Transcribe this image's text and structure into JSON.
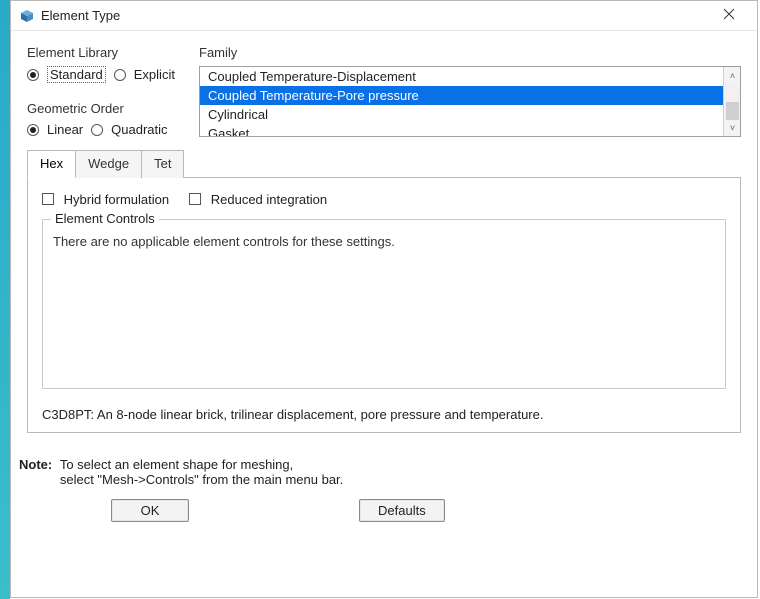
{
  "window": {
    "title": "Element Type"
  },
  "groups": {
    "element_library": {
      "label": "Element Library",
      "options": {
        "standard": "Standard",
        "explicit": "Explicit"
      },
      "selected": "standard"
    },
    "geometric_order": {
      "label": "Geometric Order",
      "options": {
        "linear": "Linear",
        "quadratic": "Quadratic"
      },
      "selected": "linear"
    },
    "family": {
      "label": "Family",
      "items": [
        "Coupled Temperature-Displacement",
        "Coupled Temperature-Pore pressure",
        "Cylindrical",
        "Gasket"
      ],
      "selected_index": 1
    }
  },
  "tabs": {
    "items": [
      "Hex",
      "Wedge",
      "Tet"
    ],
    "active_index": 0
  },
  "tab_panel": {
    "checkboxes": {
      "hybrid": "Hybrid formulation",
      "reduced": "Reduced integration"
    },
    "fieldset_label": "Element Controls",
    "fieldset_text": "There are no applicable element controls for these settings.",
    "description": "C3D8PT:  An 8-node linear brick, trilinear displacement, pore pressure and temperature."
  },
  "note": {
    "label": "Note:",
    "line1": "To select an element shape for meshing,",
    "line2": "select \"Mesh->Controls\" from the main menu bar."
  },
  "buttons": {
    "ok": "OK",
    "defaults": "Defaults"
  }
}
